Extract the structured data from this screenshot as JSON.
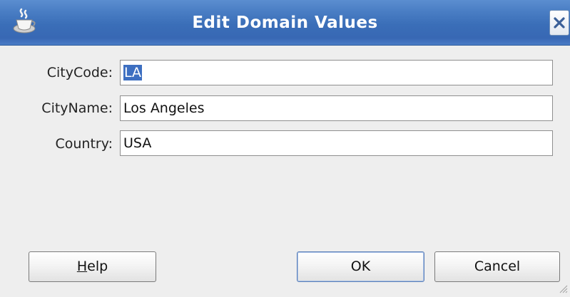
{
  "window": {
    "title": "Edit Domain Values",
    "app_icon": "coffee-cup-icon",
    "close_icon": "close-icon"
  },
  "form": {
    "fields": [
      {
        "label": "CityCode:",
        "value": "LA",
        "selected": true
      },
      {
        "label": "CityName:",
        "value": "Los Angeles",
        "selected": false
      },
      {
        "label": "Country:",
        "value": "USA",
        "selected": false
      }
    ]
  },
  "buttons": {
    "help_mnemonic": "H",
    "help_rest": "elp",
    "ok": "OK",
    "cancel": "Cancel"
  },
  "colors": {
    "titlebar": "#3a6eb8",
    "selection": "#3d6fc1",
    "background": "#eeeeee"
  }
}
